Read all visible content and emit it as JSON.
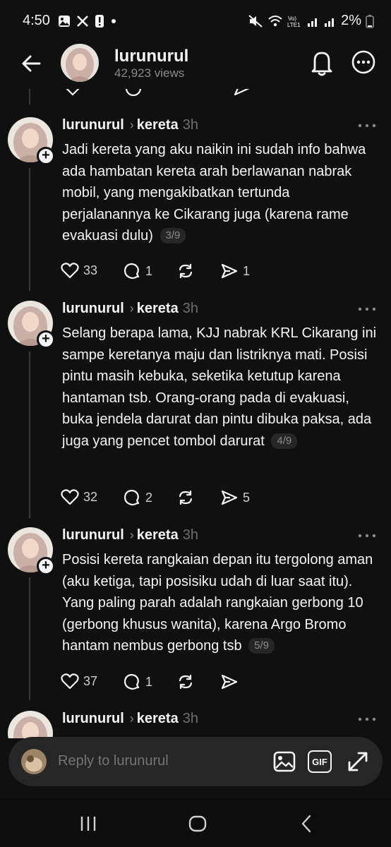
{
  "status_bar": {
    "time": "4:50",
    "battery": "2%",
    "icons_left": [
      "gallery-icon",
      "x-icon",
      "alert-icon",
      "dot-icon"
    ],
    "icons_right": [
      "mute-icon",
      "wifi-icon",
      "lte-icon",
      "signal-icon",
      "signal-icon",
      "battery-icon"
    ]
  },
  "header": {
    "username": "lurunurul",
    "views": "42,923 views"
  },
  "posts": [
    {
      "username": "lurunurul",
      "topic": "kereta",
      "time": "3h",
      "text": "Jadi kereta yang aku naikin ini sudah info bahwa ada hambatan kereta arah berlawanan nabrak mobil, yang mengakibatkan tertunda perjalanannya ke Cikarang juga (karena rame evakuasi dulu)",
      "counter": "3/9",
      "likes": "33",
      "replies": "1",
      "reposts": "",
      "shares": "1"
    },
    {
      "username": "lurunurul",
      "topic": "kereta",
      "time": "3h",
      "text": "Selang berapa lama, KJJ nabrak KRL Cikarang ini sampe keretanya maju dan listriknya mati. Posisi pintu masih kebuka, seketika ketutup karena hantaman tsb. Orang-orang pada di evakuasi, buka jendela darurat dan pintu dibuka paksa, ada juga yang pencet tombol darurat",
      "counter": "4/9",
      "likes": "32",
      "replies": "2",
      "reposts": "",
      "shares": "5"
    },
    {
      "username": "lurunurul",
      "topic": "kereta",
      "time": "3h",
      "text": "Posisi kereta rangkaian depan itu tergolong aman (aku ketiga, tapi posisiku udah di luar saat itu). Yang paling parah adalah rangkaian gerbong 10 (gerbong khusus wanita), karena Argo Bromo hantam nembus gerbong tsb",
      "counter": "5/9",
      "likes": "37",
      "replies": "1",
      "reposts": "",
      "shares": ""
    },
    {
      "username": "lurunurul",
      "topic": "kereta",
      "time": "3h"
    }
  ],
  "reply_bar": {
    "placeholder": "Reply to lurunurul",
    "gif_label": "GIF"
  },
  "colors": {
    "background": "#101010",
    "text_primary": "#f3f5f7",
    "text_secondary": "#8a8a8a",
    "reply_bar": "#262626"
  }
}
